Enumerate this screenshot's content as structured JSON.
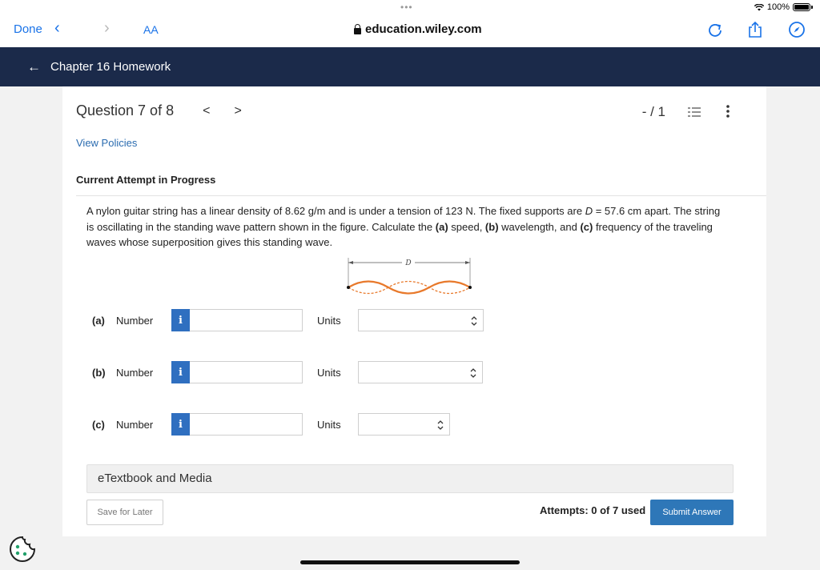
{
  "browser": {
    "done_label": "Done",
    "text_size_label": "AA",
    "url": "education.wiley.com",
    "battery": "100%",
    "tab_dots": "•••"
  },
  "header": {
    "title": "Chapter 16 Homework"
  },
  "question_nav": {
    "title": "Question 7 of 8",
    "prev": "<",
    "next": ">",
    "score": "- / 1"
  },
  "policies_link": "View Policies",
  "attempt_status": "Current Attempt in Progress",
  "question": {
    "text_1": "A nylon guitar string has a linear density of 8.62 g/m and is under a tension of 123 N. The fixed supports are ",
    "var_d": "D",
    "text_2": " = 57.6 cm apart. The string is oscillating in the standing wave pattern shown in the figure. Calculate the ",
    "a": "(a)",
    "text_3": " speed, ",
    "b": "(b)",
    "text_4": " wavelength, and ",
    "c": "(c)",
    "text_5": " frequency of the traveling waves whose superposition gives this standing wave.",
    "figure_label": "D"
  },
  "answers": [
    {
      "part": "(a)",
      "number_label": "Number",
      "info": "i",
      "value": "",
      "units_label": "Units",
      "units_value": ""
    },
    {
      "part": "(b)",
      "number_label": "Number",
      "info": "i",
      "value": "",
      "units_label": "Units",
      "units_value": ""
    },
    {
      "part": "(c)",
      "number_label": "Number",
      "info": "i",
      "value": "",
      "units_label": "Units",
      "units_value": ""
    }
  ],
  "etextbook": "eTextbook and Media",
  "save_label": "Save for Later",
  "attempts": "Attempts: 0 of 7 used",
  "submit_label": "Submit Answer",
  "colors": {
    "header_bg": "#1b2a4a",
    "accent": "#2e77b8",
    "link": "#2b6cb0",
    "wave": "#e8792b"
  }
}
